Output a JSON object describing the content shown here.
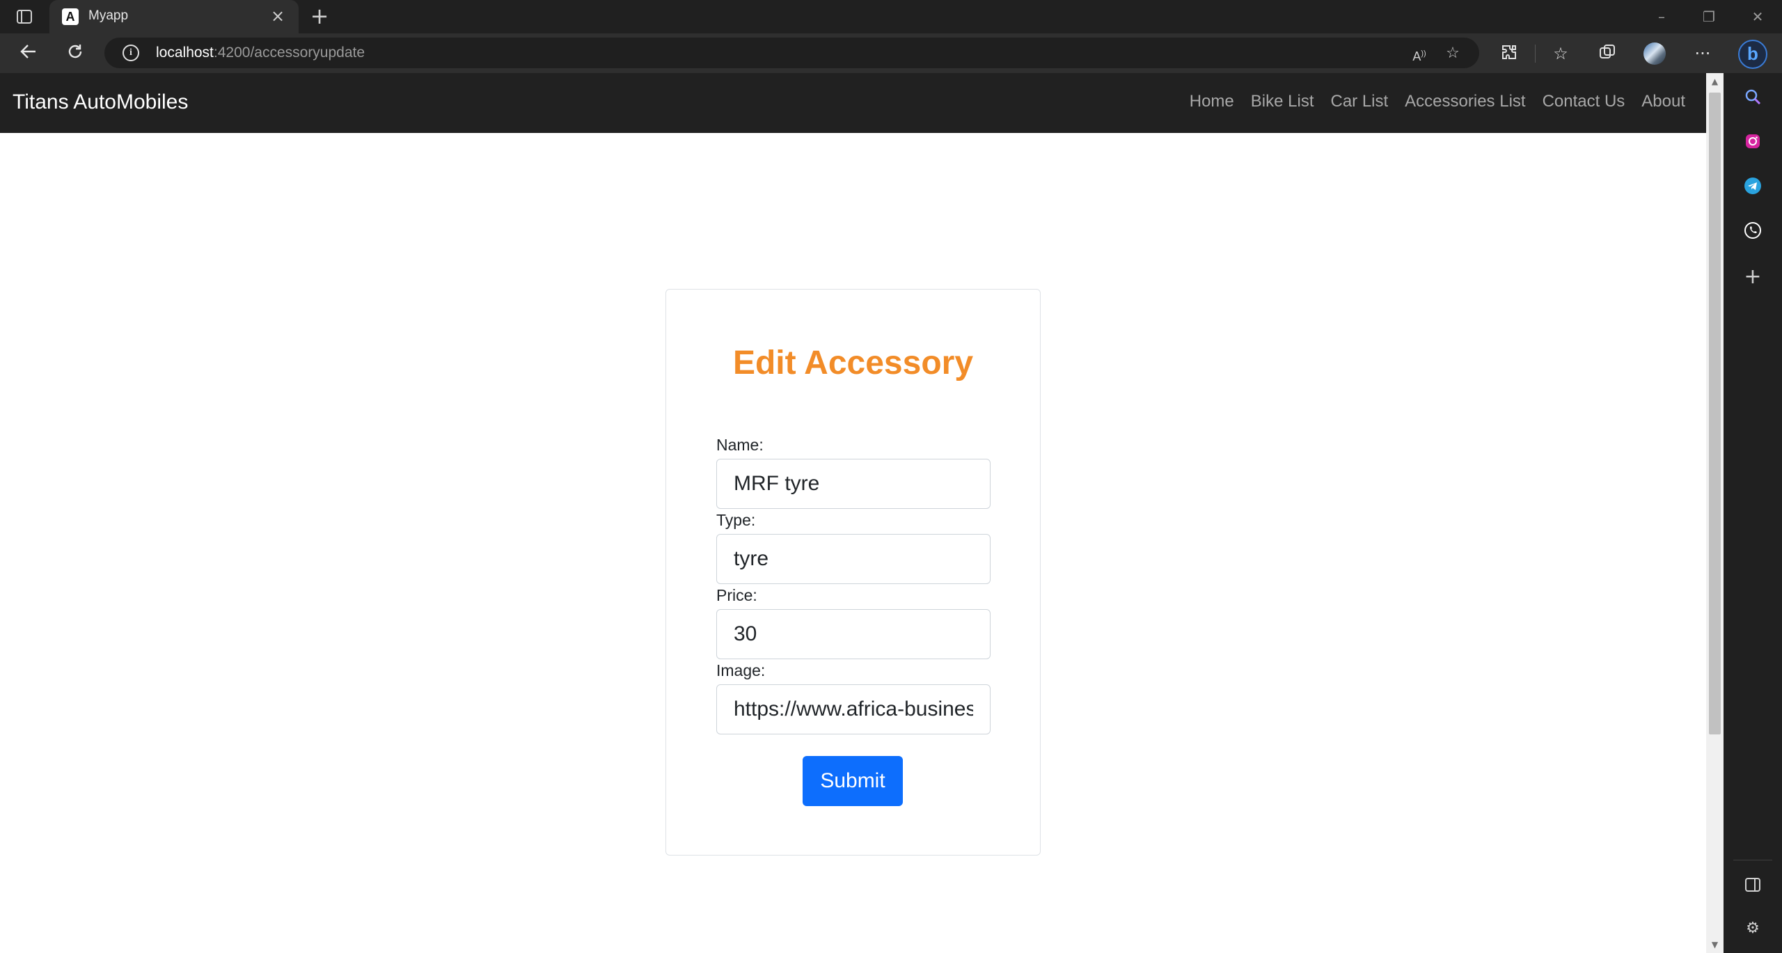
{
  "browser": {
    "tab_title": "Myapp",
    "tab_favicon": "A",
    "url_host": "localhost",
    "url_path": ":4200/accessoryupdate",
    "bing_label": "b"
  },
  "navbar": {
    "brand": "Titans AutoMobiles",
    "links": [
      "Home",
      "Bike List",
      "Car List",
      "Accessories List",
      "Contact Us",
      "About"
    ]
  },
  "form": {
    "heading": "Edit Accessory",
    "name_label": "Name:",
    "name_value": "MRF tyre",
    "type_label": "Type:",
    "type_value": "tyre",
    "price_label": "Price:",
    "price_value": "30",
    "image_label": "Image:",
    "image_value": "https://www.africa-business.com",
    "submit_label": "Submit"
  },
  "colors": {
    "heading": "#f28c28",
    "submit": "#0d6efd",
    "navbar_bg": "#212121"
  }
}
